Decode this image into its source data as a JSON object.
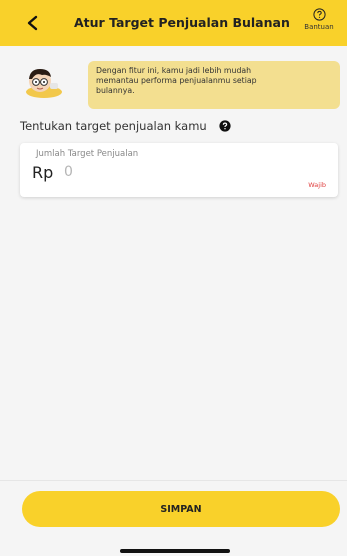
{
  "header": {
    "back_icon": "chevron-left-icon",
    "title": "Atur Target Penjualan Bulanan",
    "help_icon": "question-circle-icon",
    "help_label": "Bantuan",
    "background": "#f9d12a"
  },
  "intro": {
    "avatar": "avatar-illustration",
    "message_lines": [
      "Dengan fitur ini, kamu jadi lebih mudah",
      "memantau performa penjualanmu setiap",
      "bulannya."
    ],
    "bubble_color": "#f3df90"
  },
  "form": {
    "section_title": "Tentukan target penjualan kamu",
    "info_icon": "question-circle-filled-icon",
    "field_label": "Jumlah Target Penjualan",
    "currency": "Rp",
    "amount_placeholder": "0",
    "required_label": "Wajib"
  },
  "footer": {
    "save_label": "SIMPAN"
  }
}
